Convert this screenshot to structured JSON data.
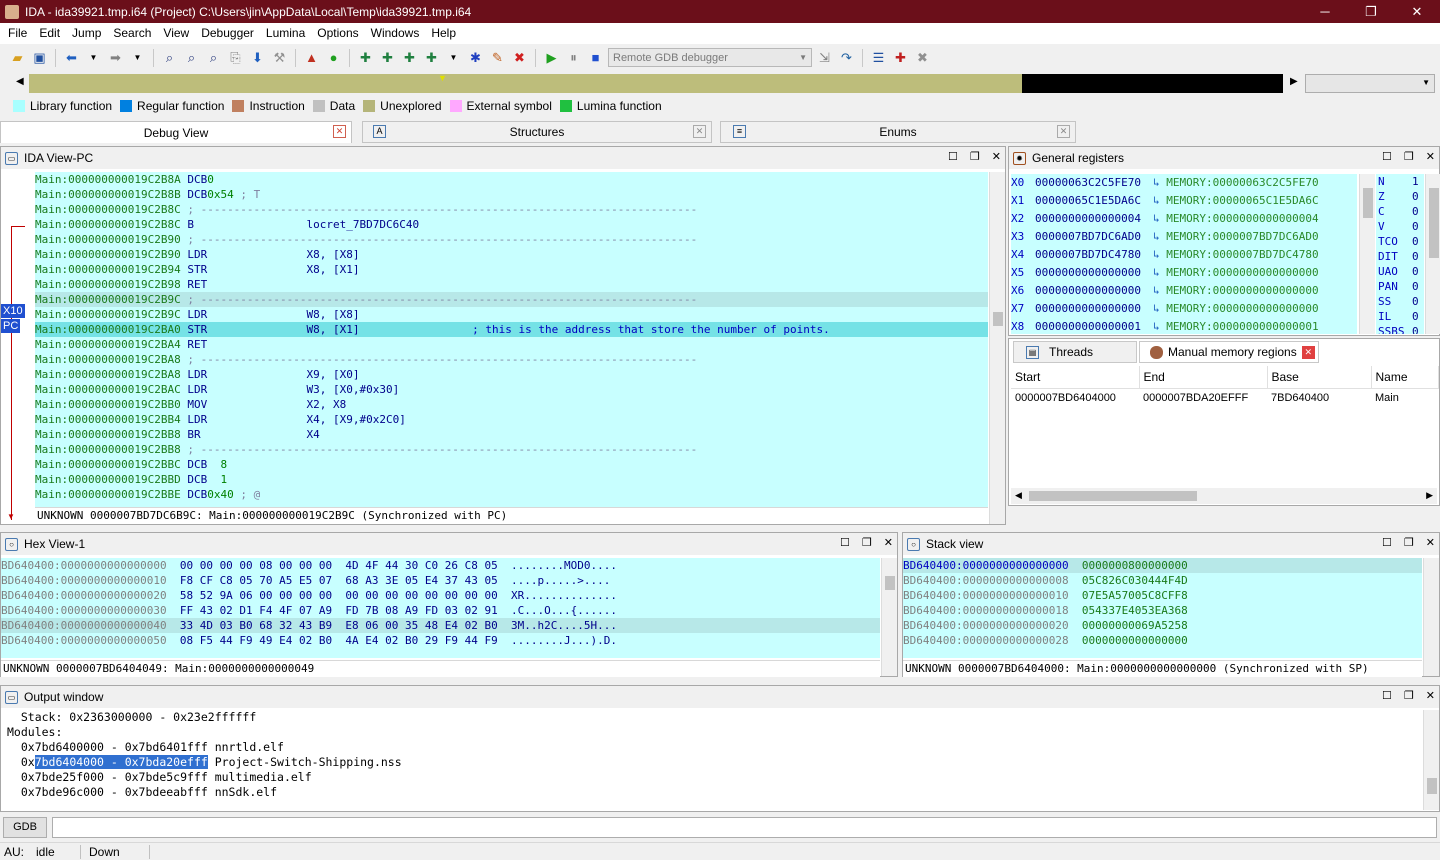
{
  "window": {
    "title": "IDA - ida39921.tmp.i64 (Project) C:\\Users\\jin\\AppData\\Local\\Temp\\ida39921.tmp.i64",
    "minimize": "─",
    "maximize": "❐",
    "close": "✕"
  },
  "menu": [
    "File",
    "Edit",
    "Jump",
    "Search",
    "View",
    "Debugger",
    "Lumina",
    "Options",
    "Windows",
    "Help"
  ],
  "toolbar": {
    "debugger_select": "Remote GDB debugger"
  },
  "legend": [
    {
      "label": "Library function",
      "color": "#a8ffff"
    },
    {
      "label": "Regular function",
      "color": "#0080e0"
    },
    {
      "label": "Instruction",
      "color": "#c08060"
    },
    {
      "label": "Data",
      "color": "#c0c0c0"
    },
    {
      "label": "Unexplored",
      "color": "#b5b57a"
    },
    {
      "label": "External symbol",
      "color": "#ffa8ff"
    },
    {
      "label": "Lumina function",
      "color": "#20c040"
    }
  ],
  "tabs": {
    "debug_view": "Debug View",
    "structures": "Structures",
    "enums": "Enums"
  },
  "ida_view": {
    "title": "IDA View-PC",
    "reg_tags": [
      "X10",
      "PC"
    ],
    "lines": [
      {
        "a": "Main:000000000019C2B8A",
        "m": "DCB",
        "o": "0",
        "c": ""
      },
      {
        "a": "Main:000000000019C2B8B",
        "m": "DCB",
        "o": "0x54",
        "c": "; T"
      },
      {
        "a": "Main:000000000019C2B8C",
        "m": "",
        "o": "",
        "c": "; ---------------------------------------------------------------------------"
      },
      {
        "a": "Main:000000000019C2B8C",
        "m": "B",
        "o": "                 locret_7BD7DC6C40",
        "c": ""
      },
      {
        "a": "Main:000000000019C2B90",
        "m": "",
        "o": "",
        "c": "; ---------------------------------------------------------------------------"
      },
      {
        "a": "Main:000000000019C2B90",
        "m": "LDR",
        "o": "               X8, [X8]",
        "c": ""
      },
      {
        "a": "Main:000000000019C2B94",
        "m": "STR",
        "o": "               X8, [X1]",
        "c": ""
      },
      {
        "a": "Main:000000000019C2B98",
        "m": "RET",
        "o": "",
        "c": ""
      },
      {
        "a": "Main:000000000019C2B9C",
        "m": "",
        "o": "",
        "c": "; ---------------------------------------------------------------------------"
      },
      {
        "a": "Main:000000000019C2B9C",
        "m": "LDR",
        "o": "               W8, [X8]",
        "c": ""
      },
      {
        "a": "Main:000000000019C2BA0",
        "m": "STR",
        "o": "               W8, [X1]",
        "c": "                ; this is the address that store the number of points."
      },
      {
        "a": "Main:000000000019C2BA4",
        "m": "RET",
        "o": "",
        "c": ""
      },
      {
        "a": "Main:000000000019C2BA8",
        "m": "",
        "o": "",
        "c": "; ---------------------------------------------------------------------------"
      },
      {
        "a": "Main:000000000019C2BA8",
        "m": "LDR",
        "o": "               X9, [X0]",
        "c": ""
      },
      {
        "a": "Main:000000000019C2BAC",
        "m": "LDR",
        "o": "               W3, [X0,#0x30]",
        "c": ""
      },
      {
        "a": "Main:000000000019C2BB0",
        "m": "MOV",
        "o": "               X2, X8",
        "c": ""
      },
      {
        "a": "Main:000000000019C2BB4",
        "m": "LDR",
        "o": "               X4, [X9,#0x2C0]",
        "c": ""
      },
      {
        "a": "Main:000000000019C2BB8",
        "m": "BR",
        "o": "                X4",
        "c": ""
      },
      {
        "a": "Main:000000000019C2BB8",
        "m": "",
        "o": "",
        "c": "; ---------------------------------------------------------------------------"
      },
      {
        "a": "Main:000000000019C2BBC",
        "m": "DCB",
        "o": "  8",
        "c": ""
      },
      {
        "a": "Main:000000000019C2BBD",
        "m": "DCB",
        "o": "  1",
        "c": ""
      },
      {
        "a": "Main:000000000019C2BBE",
        "m": "DCB",
        "o": "0x40",
        "c": "; @"
      }
    ],
    "status": "UNKNOWN 0000007BD7DC6B9C: Main:000000000019C2B9C (Synchronized with PC)"
  },
  "registers": {
    "title": "General registers",
    "rows": [
      {
        "n": "X0",
        "v": "00000063C2C5FE70",
        "m": "MEMORY:00000063C2C5FE70"
      },
      {
        "n": "X1",
        "v": "00000065C1E5DA6C",
        "m": "MEMORY:00000065C1E5DA6C"
      },
      {
        "n": "X2",
        "v": "0000000000000004",
        "m": "MEMORY:0000000000000004"
      },
      {
        "n": "X3",
        "v": "0000007BD7DC6AD0",
        "m": "MEMORY:0000007BD7DC6AD0"
      },
      {
        "n": "X4",
        "v": "0000007BD7DC4780",
        "m": "MEMORY:0000007BD7DC4780"
      },
      {
        "n": "X5",
        "v": "0000000000000000",
        "m": "MEMORY:0000000000000000"
      },
      {
        "n": "X6",
        "v": "0000000000000000",
        "m": "MEMORY:0000000000000000"
      },
      {
        "n": "X7",
        "v": "0000000000000000",
        "m": "MEMORY:0000000000000000"
      },
      {
        "n": "X8",
        "v": "0000000000000001",
        "m": "MEMORY:0000000000000001"
      }
    ],
    "flags": [
      {
        "n": "N",
        "v": "1"
      },
      {
        "n": "Z",
        "v": "0"
      },
      {
        "n": "C",
        "v": "0"
      },
      {
        "n": "V",
        "v": "0"
      },
      {
        "n": "TCO",
        "v": "0"
      },
      {
        "n": "DIT",
        "v": "0"
      },
      {
        "n": "UAO",
        "v": "0"
      },
      {
        "n": "PAN",
        "v": "0"
      },
      {
        "n": "SS",
        "v": "0"
      },
      {
        "n": "IL",
        "v": "0"
      },
      {
        "n": "SSBS",
        "v": "0"
      }
    ]
  },
  "memregions": {
    "tab_threads": "Threads",
    "tab_manual": "Manual memory regions",
    "headers": [
      "Start",
      "End",
      "Base",
      "Name"
    ],
    "rows": [
      [
        "0000007BD6404000",
        "0000007BDA20EFFF",
        "7BD640400",
        "Main"
      ]
    ]
  },
  "hexview": {
    "title": "Hex View-1",
    "rows": [
      {
        "a": "BD640400:0000000000000000",
        "h1": "00 00 00 00 08 00 00 00",
        "h2": "4D 4F 44 30 C0 26 C8 05",
        "t": "........MOD0...."
      },
      {
        "a": "BD640400:0000000000000010",
        "h1": "F8 CF C8 05 70 A5 E5 07",
        "h2": "68 A3 3E 05 E4 37 43 05",
        "t": "....p.....>...."
      },
      {
        "a": "BD640400:0000000000000020",
        "h1": "58 52 9A 06 00 00 00 00",
        "h2": "00 00 00 00 00 00 00 00",
        "t": "XR.............."
      },
      {
        "a": "BD640400:0000000000000030",
        "h1": "FF 43 02 D1 F4 4F 07 A9",
        "h2": "FD 7B 08 A9 FD 03 02 91",
        "t": ".C...O...{......"
      },
      {
        "a": "BD640400:0000000000000040",
        "h1": "33 4D 03 B0 68 32 43 B9",
        "h2": "E8 06 00 35 48 E4 02 B0",
        "t": "3M..h2C....5H..."
      },
      {
        "a": "BD640400:0000000000000050",
        "h1": "08 F5 44 F9 49 E4 02 B0",
        "h2": "4A E4 02 B0 29 F9 44 F9",
        "t": "........J...).D."
      }
    ],
    "status": "UNKNOWN 0000007BD6404049: Main:0000000000000049"
  },
  "stackview": {
    "title": "Stack view",
    "rows": [
      {
        "a": "BD640400:0000000000000000",
        "v": "0000000800000000"
      },
      {
        "a": "BD640400:0000000000000008",
        "v": "05C826C030444F4D"
      },
      {
        "a": "BD640400:0000000000000010",
        "v": "07E5A57005C8CFF8"
      },
      {
        "a": "BD640400:0000000000000018",
        "v": "054337E4053EA368"
      },
      {
        "a": "BD640400:0000000000000020",
        "v": "00000000069A5258"
      },
      {
        "a": "BD640400:0000000000000028",
        "v": "0000000000000000"
      }
    ],
    "status": "UNKNOWN 0000007BD6404000: Main:0000000000000000 (Synchronized with SP)"
  },
  "output": {
    "title": "Output window",
    "lines": [
      "  Stack: 0x2363000000 - 0x23e2ffffff",
      "Modules:",
      "  0x7bd6400000 - 0x7bd6401fff nnrtld.elf",
      "  0x7bd6404000 - 0x7bda20efff Project-Switch-Shipping.nss",
      "  0x7bde25f000 - 0x7bde5c9fff multimedia.elf",
      "  0x7bde96c000 - 0x7bdeeabfff nnSdk.elf"
    ]
  },
  "cmd": {
    "button": "GDB"
  },
  "statusbar": {
    "au": "AU:",
    "state": "idle",
    "dir": "Down"
  }
}
